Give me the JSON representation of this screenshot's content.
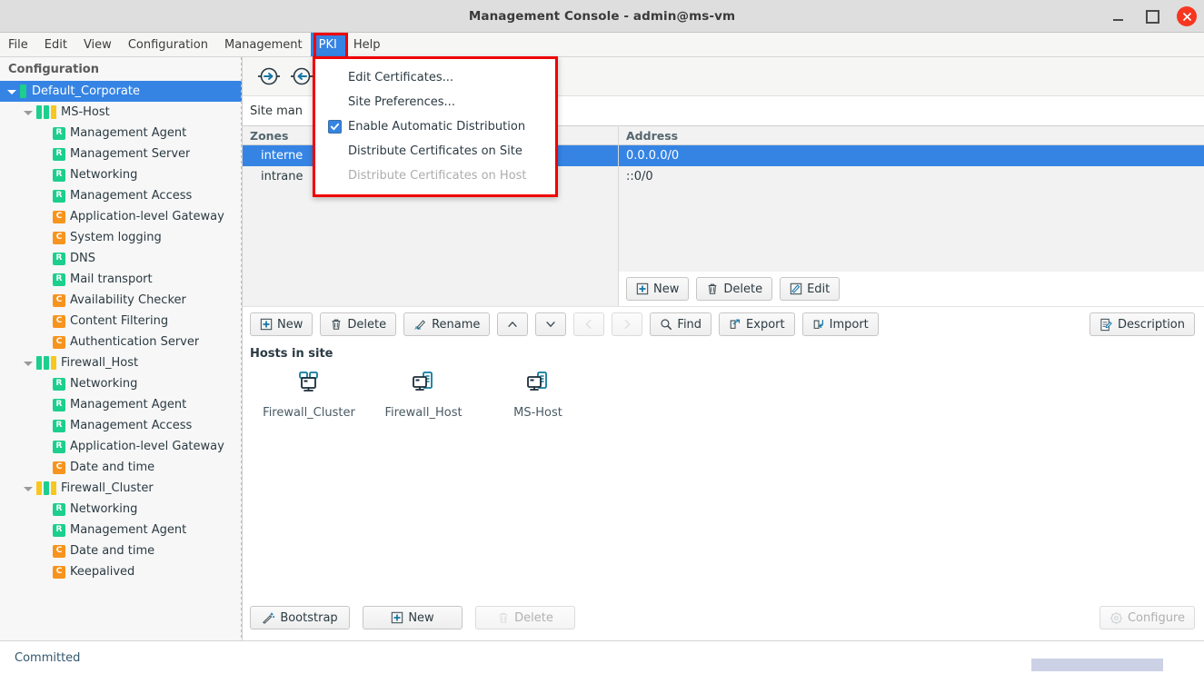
{
  "window": {
    "title": "Management Console - admin@ms-vm",
    "minimize_label": "Minimize",
    "maximize_label": "Maximize",
    "close_label": "Close"
  },
  "menubar": {
    "items": [
      {
        "label": "File",
        "active": false
      },
      {
        "label": "Edit",
        "active": false
      },
      {
        "label": "View",
        "active": false
      },
      {
        "label": "Configuration",
        "active": false
      },
      {
        "label": "Management",
        "active": false
      },
      {
        "label": "PKI",
        "active": true
      },
      {
        "label": "Help",
        "active": false
      }
    ]
  },
  "pki_menu": {
    "items": [
      {
        "label": "Edit Certificates...",
        "checkbox": false,
        "checked": false,
        "disabled": false
      },
      {
        "label": "Site Preferences...",
        "checkbox": false,
        "checked": false,
        "disabled": false
      },
      {
        "label": "Enable Automatic Distribution",
        "checkbox": true,
        "checked": true,
        "disabled": false
      },
      {
        "label": "Distribute Certificates on Site",
        "checkbox": false,
        "checked": false,
        "disabled": false
      },
      {
        "label": "Distribute Certificates on Host",
        "checkbox": false,
        "checked": false,
        "disabled": true
      }
    ]
  },
  "sidebar": {
    "header": "Configuration",
    "tree": [
      {
        "label": "Default_Corporate",
        "indent": 0,
        "twisty": true,
        "selected": true,
        "marker": "single",
        "colors": [
          "#1ccf8c"
        ]
      },
      {
        "label": "MS-Host",
        "indent": 1,
        "twisty": true,
        "selected": false,
        "marker": "bars",
        "colors": [
          "#1ccf8c",
          "#1ccf8c",
          "#f7c71e"
        ]
      },
      {
        "label": "Management Agent",
        "indent": 2,
        "twisty": false,
        "selected": false,
        "marker": "badge",
        "badge": "R"
      },
      {
        "label": "Management Server",
        "indent": 2,
        "twisty": false,
        "selected": false,
        "marker": "badge",
        "badge": "R"
      },
      {
        "label": "Networking",
        "indent": 2,
        "twisty": false,
        "selected": false,
        "marker": "badge",
        "badge": "R"
      },
      {
        "label": "Management Access",
        "indent": 2,
        "twisty": false,
        "selected": false,
        "marker": "badge",
        "badge": "R"
      },
      {
        "label": "Application-level Gateway",
        "indent": 2,
        "twisty": false,
        "selected": false,
        "marker": "badge",
        "badge": "C"
      },
      {
        "label": "System logging",
        "indent": 2,
        "twisty": false,
        "selected": false,
        "marker": "badge",
        "badge": "C"
      },
      {
        "label": "DNS",
        "indent": 2,
        "twisty": false,
        "selected": false,
        "marker": "badge",
        "badge": "R"
      },
      {
        "label": "Mail transport",
        "indent": 2,
        "twisty": false,
        "selected": false,
        "marker": "badge",
        "badge": "R"
      },
      {
        "label": "Availability Checker",
        "indent": 2,
        "twisty": false,
        "selected": false,
        "marker": "badge",
        "badge": "C"
      },
      {
        "label": "Content Filtering",
        "indent": 2,
        "twisty": false,
        "selected": false,
        "marker": "badge",
        "badge": "C"
      },
      {
        "label": "Authentication Server",
        "indent": 2,
        "twisty": false,
        "selected": false,
        "marker": "badge",
        "badge": "C"
      },
      {
        "label": "Firewall_Host",
        "indent": 1,
        "twisty": true,
        "selected": false,
        "marker": "bars",
        "colors": [
          "#1ccf8c",
          "#1ccf8c",
          "#f7c71e"
        ]
      },
      {
        "label": "Networking",
        "indent": 2,
        "twisty": false,
        "selected": false,
        "marker": "badge",
        "badge": "R"
      },
      {
        "label": "Management Agent",
        "indent": 2,
        "twisty": false,
        "selected": false,
        "marker": "badge",
        "badge": "R"
      },
      {
        "label": "Management Access",
        "indent": 2,
        "twisty": false,
        "selected": false,
        "marker": "badge",
        "badge": "R"
      },
      {
        "label": "Application-level Gateway",
        "indent": 2,
        "twisty": false,
        "selected": false,
        "marker": "badge",
        "badge": "R"
      },
      {
        "label": "Date and time",
        "indent": 2,
        "twisty": false,
        "selected": false,
        "marker": "badge",
        "badge": "C"
      },
      {
        "label": "Firewall_Cluster",
        "indent": 1,
        "twisty": true,
        "selected": false,
        "marker": "bars",
        "colors": [
          "#f7c71e",
          "#1ccf8c",
          "#f7c71e"
        ]
      },
      {
        "label": "Networking",
        "indent": 2,
        "twisty": false,
        "selected": false,
        "marker": "badge",
        "badge": "R"
      },
      {
        "label": "Management Agent",
        "indent": 2,
        "twisty": false,
        "selected": false,
        "marker": "badge",
        "badge": "R"
      },
      {
        "label": "Date and time",
        "indent": 2,
        "twisty": false,
        "selected": false,
        "marker": "badge",
        "badge": "C"
      },
      {
        "label": "Keepalived",
        "indent": 2,
        "twisty": false,
        "selected": false,
        "marker": "badge",
        "badge": "C"
      }
    ]
  },
  "main": {
    "section_title": "Site man",
    "zones_table": {
      "header": "Zones",
      "rows": [
        {
          "label": "interne",
          "selected": true
        },
        {
          "label": "intrane",
          "selected": false
        }
      ]
    },
    "address_table": {
      "header": "Address",
      "rows": [
        {
          "label": "0.0.0.0/0",
          "selected": true
        },
        {
          "label": "::0/0",
          "selected": false
        }
      ]
    },
    "address_buttons": [
      {
        "label": "New",
        "icon": "plus-icon",
        "disabled": false
      },
      {
        "label": "Delete",
        "icon": "trash-icon",
        "disabled": false
      },
      {
        "label": "Edit",
        "icon": "pencil-icon",
        "disabled": false
      }
    ],
    "zone_buttons": [
      {
        "label": "New",
        "icon": "plus-icon",
        "disabled": false
      },
      {
        "label": "Delete",
        "icon": "trash-icon",
        "disabled": false
      },
      {
        "label": "Rename",
        "icon": "rename-icon",
        "disabled": false
      },
      {
        "label": "",
        "icon": "chevron-up-icon",
        "disabled": false
      },
      {
        "label": "",
        "icon": "chevron-down-icon",
        "disabled": false
      },
      {
        "label": "",
        "icon": "chevron-left-icon",
        "disabled": true
      },
      {
        "label": "",
        "icon": "chevron-right-icon",
        "disabled": true
      },
      {
        "label": "Find",
        "icon": "search-icon",
        "disabled": false
      },
      {
        "label": "Export",
        "icon": "export-icon",
        "disabled": false
      },
      {
        "label": "Import",
        "icon": "import-icon",
        "disabled": false
      }
    ],
    "description_button": {
      "label": "Description",
      "icon": "description-icon",
      "disabled": false
    },
    "hosts_heading": "Hosts in site",
    "hosts": [
      {
        "label": "Firewall_Cluster",
        "icon": "cluster-host-icon"
      },
      {
        "label": "Firewall_Host",
        "icon": "host-icon"
      },
      {
        "label": "MS-Host",
        "icon": "host-icon"
      }
    ],
    "host_buttons": [
      {
        "label": "Bootstrap",
        "icon": "wand-icon",
        "disabled": false
      },
      {
        "label": "New",
        "icon": "plus-icon",
        "disabled": false
      },
      {
        "label": "Delete",
        "icon": "trash-icon",
        "disabled": true
      }
    ],
    "configure_button": {
      "label": "Configure",
      "icon": "gear-icon",
      "disabled": true
    }
  },
  "statusbar": {
    "text": "Committed"
  },
  "colors": {
    "accent": "#3584e4",
    "highlight_box": "#f00000",
    "badge_r": "#1ccf8c",
    "badge_c": "#f7941e",
    "bar_yellow": "#f7c71e",
    "icon_teal": "#0f7b9c",
    "close_red": "#f6361f"
  }
}
